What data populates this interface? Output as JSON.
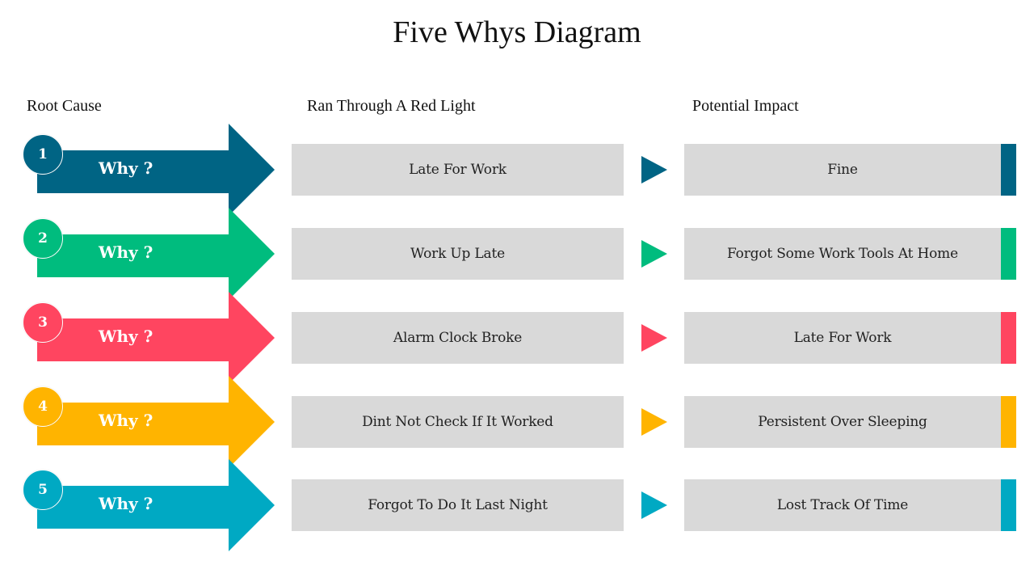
{
  "title": "Five Whys Diagram",
  "headers": {
    "root_cause": "Root Cause",
    "problem": "Ran Through A Red Light",
    "impact": "Potential Impact"
  },
  "rows": [
    {
      "number": "1",
      "why_label": "Why ?",
      "cause": "Late For Work",
      "impact": "Fine",
      "color": "#006484"
    },
    {
      "number": "2",
      "why_label": "Why ?",
      "cause": "Work Up Late",
      "impact": "Forgot Some Work Tools At Home",
      "color": "#00bc7e"
    },
    {
      "number": "3",
      "why_label": "Why ?",
      "cause": "Alarm Clock Broke",
      "impact": "Late For Work",
      "color": "#ff4560"
    },
    {
      "number": "4",
      "why_label": "Why ?",
      "cause": "Dint Not Check If It Worked",
      "impact": "Persistent Over Sleeping",
      "color": "#ffb400"
    },
    {
      "number": "5",
      "why_label": "Why ?",
      "cause": "Forgot To Do It Last Night",
      "impact": "Lost Track Of Time",
      "color": "#00a9c3"
    }
  ],
  "icons": {
    "arrow": "arrow-right-shape",
    "pointer": "triangle-right-icon"
  }
}
